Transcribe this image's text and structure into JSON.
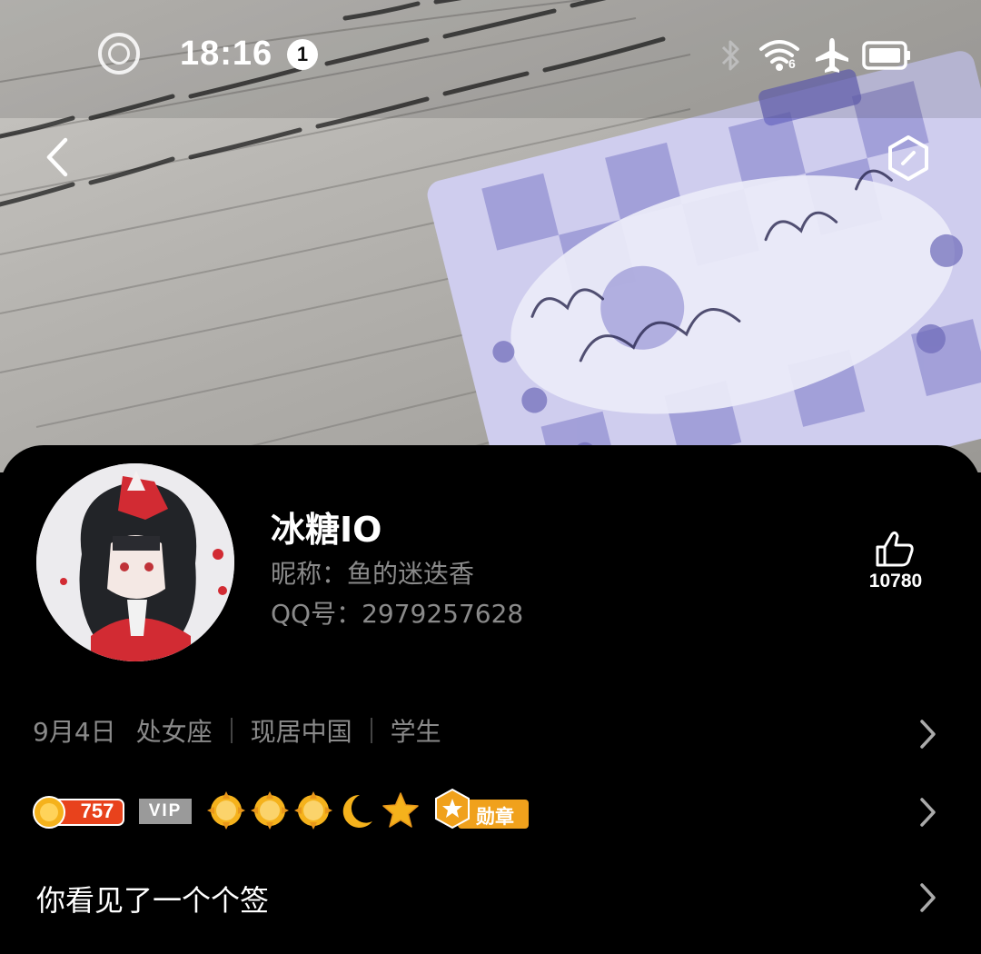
{
  "status_bar": {
    "time": "18:16",
    "notification_count": "1",
    "wifi_label": "6",
    "icons": [
      "bluetooth-icon",
      "wifi-icon",
      "airplane-icon",
      "battery-icon"
    ]
  },
  "navigation": {
    "back_icon": "chevron-left-icon",
    "action_icon": "hexagon-minus-icon"
  },
  "profile": {
    "display_name": "冰糖IO",
    "nickname": "昵称：鱼的迷迭香",
    "qq_number": "QQ号：2979257628",
    "likes": "10780"
  },
  "info": {
    "birthday": "9月4日",
    "zodiac": "处女座",
    "location": "现居中国",
    "occupation": "学生"
  },
  "badges": {
    "level": "757",
    "vip": "VIP",
    "medal_label": "勋章",
    "level_icons": [
      "sun-icon",
      "sun-icon",
      "sun-icon",
      "moon-icon",
      "star-icon"
    ]
  },
  "signature": "你看见了一个个签",
  "colors": {
    "background": "#000000",
    "secondary_text": "#8a8a8a",
    "level_badge": "#e8421c",
    "medal_badge": "#f0a11c",
    "vip_badge": "#9a9a9a",
    "sun": "#f5b21c"
  }
}
